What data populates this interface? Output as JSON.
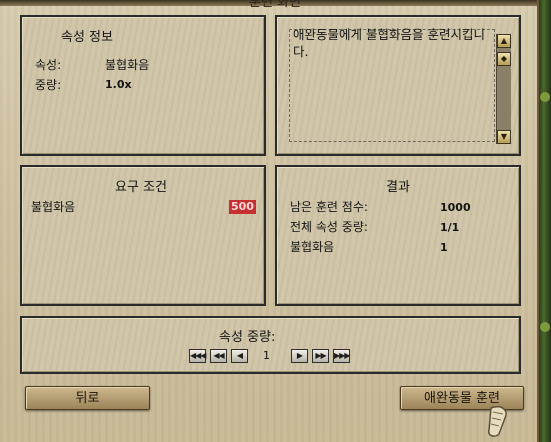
{
  "window": {
    "title_fragment": "훈련 화면"
  },
  "attribute_info": {
    "heading": "속성 정보",
    "attribute_label": "속성:",
    "attribute_value": "불협화음",
    "weight_label": "중량:",
    "weight_value": "1.0x"
  },
  "description": {
    "text": "애완동물에게 불협화음을 훈련시킵니다."
  },
  "requirements": {
    "heading": "요구 조건",
    "skill_name": "불협화음",
    "cost": "500"
  },
  "result": {
    "heading": "결과",
    "remaining_points_label": "남은 훈련 점수:",
    "remaining_points_value": "1000",
    "total_weight_label": "전체 속성 중량:",
    "total_weight_value": "1/1",
    "skill_label": "불협화음",
    "skill_value": "1"
  },
  "attribute_weight": {
    "heading": "속성 중량:",
    "value": "1"
  },
  "buttons": {
    "back": "뒤로",
    "train": "애완동물 훈련"
  },
  "colors": {
    "parchment": "#cfc4a6",
    "panel_border": "#2b2b2b",
    "cost_highlight": "#c73030"
  }
}
